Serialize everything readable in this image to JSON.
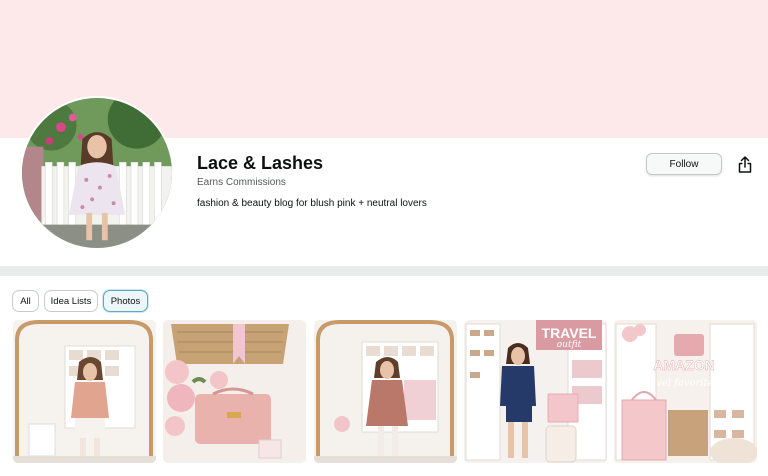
{
  "profile": {
    "name": "Lace & Lashes",
    "earns": "Earns Commissions",
    "bio": "fashion & beauty blog for blush pink + neutral lovers",
    "follow_label": "Follow",
    "share_icon": "share-icon"
  },
  "tabs": [
    {
      "label": "All",
      "active": false
    },
    {
      "label": "Idea Lists",
      "active": false
    },
    {
      "label": "Photos",
      "active": true
    }
  ],
  "photos": [
    {
      "overlay_lines": []
    },
    {
      "overlay_lines": []
    },
    {
      "overlay_lines": []
    },
    {
      "overlay_lines": [
        "TRAVEL",
        "outfit"
      ]
    },
    {
      "overlay_lines": [
        "AMAZON",
        "travel favorites"
      ]
    }
  ],
  "colors": {
    "banner": "#fde8ea",
    "accent": "#5fa8c4",
    "page_bg": "#e8edec"
  }
}
